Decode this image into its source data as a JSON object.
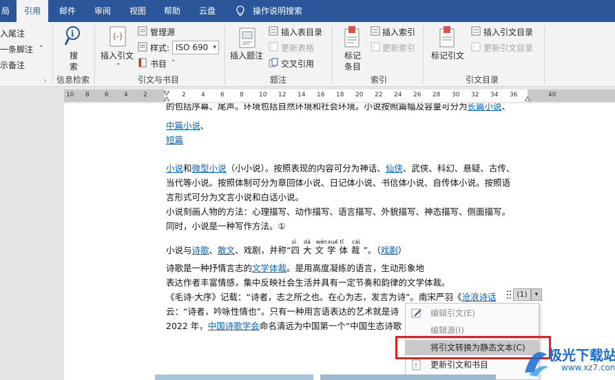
{
  "tabs": [
    {
      "label": "局",
      "active": false
    },
    {
      "label": "引用",
      "active": true
    },
    {
      "label": "邮件",
      "active": false
    },
    {
      "label": "审阅",
      "active": false
    },
    {
      "label": "视图",
      "active": false
    },
    {
      "label": "帮助",
      "active": false
    },
    {
      "label": "云盘",
      "active": false
    },
    {
      "label": "操作说明搜索",
      "active": false
    }
  ],
  "ribbon": {
    "footnotes": {
      "insert_endnote": "入尾注",
      "next_footnote": "一条脚注",
      "show_notes": "示备注"
    },
    "research": {
      "search_top": "搜",
      "search_bottom": "索",
      "group_label": "信息检索"
    },
    "citations": {
      "insert_citation": "插入引文",
      "manage_sources": "管理源",
      "style_label": "样式:",
      "style_value": "ISO 690",
      "bibliography": "书目",
      "group_label": "引文与书目"
    },
    "captions": {
      "insert_caption": "插入题注",
      "insert_table_of_figures": "插入表目录",
      "update_table": "更新表格",
      "cross_reference": "交叉引用",
      "group_label": "题注"
    },
    "index": {
      "mark_entry_top": "标记",
      "mark_entry_bottom": "条目",
      "insert_index": "插入索引",
      "update_index": "更新索引",
      "group_label": "索引"
    },
    "toa": {
      "mark_citation": "标记引文",
      "insert_toa": "插入引文目录",
      "update_toa": "更新引文目录",
      "group_label": "引文目录"
    }
  },
  "ruler": {
    "ticks": [
      "10",
      "8",
      "6",
      "4",
      "2",
      "",
      "2",
      "4",
      "6",
      "8",
      "10",
      "12",
      "14",
      "16",
      "18",
      "20",
      "22",
      "24",
      "26",
      "28",
      "30",
      "32",
      "34",
      "36",
      "",
      "40"
    ]
  },
  "document": {
    "line0_pre": "的包括序幕、尾声。环境包括自然环境和社会环境。小说按照篇幅及容量可分为",
    "line0_link": "长篇小说",
    "line0_post": "、",
    "line1_link": "中篇小说",
    "line1_post": "、",
    "line2_link": "短篇",
    "line3_link1": "小说",
    "line3_t1": "和",
    "line3_link2": "微型小说",
    "line3_t2": "（小小说）。按照表现的内容可分为神话、",
    "line3_link3": "仙侠",
    "line3_t3": "、武侠、科幻、悬疑、古传、",
    "line4": "当代等小说。按照体制可分为章回体小说、日记体小说、书信体小说、自传体小说。按照语",
    "line5": "言形式可分为文言小说和白话小说。",
    "line6": "小说刻画人物的方法：心理描写、动作描写、语言描写、外貌描写、神态描写、侧面描写。",
    "line7": "同时，小说是一种写作方法。①",
    "line8_t1": "小说与",
    "line8_link1": "诗歌",
    "line8_t2": "、",
    "line8_link2": "散文",
    "line8_t3": "、戏剧，并称“",
    "line8_ruby_text": "四大文学体裁",
    "line8_pinyin": [
      "sì",
      "dà",
      "wén",
      "xué",
      "tǐ",
      "cái"
    ],
    "line8_t4": "”。（",
    "line8_link3": "戏剧",
    "line8_t5": "）",
    "line9_t1": "诗歌是一种抒情言志的",
    "line9_link": "文学体裁",
    "line9_t2": "。是用高度凝练的语言，生动形象地",
    "line10": "表达作者丰富情感，集中反映社会生活并具有一定节奏和韵律的文学体裁。",
    "line11_t1": "《毛诗·大序》记载：“诗者，志之所之也。在心为志，发言为诗”。南宋严羽《",
    "line11_link": "沧浪诗话",
    "line11_cite": "(1)",
    "line12": "云：“诗者，吟咏性情也”。只有一种用言语表达的艺术就是诗",
    "line13_t1": "2022 年，",
    "line13_link": "中国诗歌学会",
    "line13_t2": "命名清远为中国第一个“中国生态诗歌"
  },
  "context_menu": {
    "items": [
      {
        "label": "编辑引文(E)",
        "disabled": true,
        "highlighted": false
      },
      {
        "label": "编辑源(I)",
        "disabled": true,
        "highlighted": false
      },
      {
        "label": "将引文转换为静态文本(C)",
        "disabled": false,
        "highlighted": true
      },
      {
        "label": "更新引文和书目",
        "disabled": false,
        "highlighted": false
      }
    ]
  },
  "watermark": {
    "name": "极光下载站",
    "url": "www.xz7.com"
  },
  "colors": {
    "tab_bar": "#2b579a",
    "link": "#0563c1",
    "highlight_box": "#e02020"
  }
}
